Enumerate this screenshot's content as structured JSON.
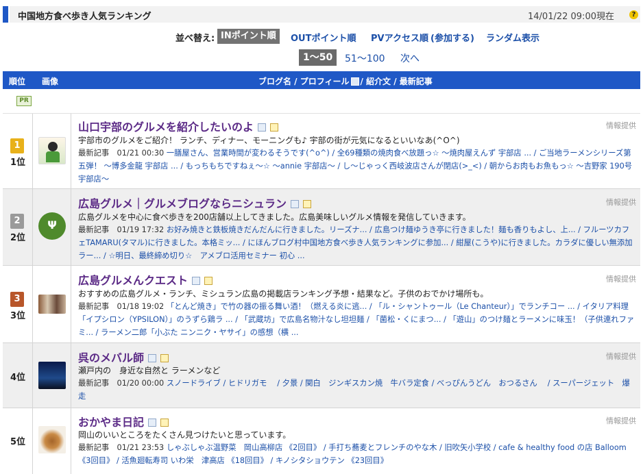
{
  "header": {
    "title": "中国地方食べ歩き人気ランキング",
    "datetime": "14/01/22 09:00現在",
    "help_icon": "question-circle-icon",
    "accent_color": "#1f58c6"
  },
  "sort": {
    "label": "並べ替え:",
    "active": "INポイント順",
    "options": [
      "OUTポイント順",
      "PVアクセス順",
      "(参加する)",
      "ランダム表示"
    ]
  },
  "pager": {
    "current": "1〜50",
    "next_range": "51〜100",
    "next": "次へ"
  },
  "table": {
    "headers": {
      "rank": "順位",
      "image": "画像",
      "main_pre": "ブログ名 / プロフィール",
      "main_post": "/ 紹介文 / 最新記事"
    },
    "pr_badge": "PR",
    "latest_label": "最新記事",
    "info_label": "情報提供"
  },
  "rows": [
    {
      "rank_num": "1",
      "rank": "1位",
      "title": "山口宇部のグルメを紹介したいのよ",
      "desc": "宇部市のグルメをご紹介！ ランチ、ディナー、モーニングも♪ 宇部の街が元気になるといいなあ(^O^)",
      "date": "01/21 00:30",
      "articles": "一膳屋さん、営業時間が変わるそうです(^o^) / 全69種類の焼肉食べ放題っ☆ 〜焼肉屋えんず 宇部店 ... / ご当地ラーメンシリーズ第五弾！ 〜博多金龍 宇部店 ... / もっちもちですねぇ〜☆ 〜annie 宇部店〜 / し〜じゃっく西岐波店さんが閉店(>_<) / 朝からお肉もお魚もっ☆ 〜吉野家 190号宇部店〜"
    },
    {
      "rank_num": "2",
      "rank": "2位",
      "title": "広島グルメ｜グルメブログならニシュラン",
      "desc": "広島グルメを中心に食べ歩きを200店舗以上してきました。広島美味しいグルメ情報を発信していきます。",
      "date": "01/19 17:32",
      "articles": "お好み焼きと鉄板焼きだんだんに行きました。リーズナ... / 広島つけ麺ゆうき亭に行きました！麺も香りもよし、上... / フルーツカフェTAMARU(タマル)に行きました。本格ミッ... / にほんブログ村中国地方食べ歩き人気ランキングに参加... / 紺屋(こうや)に行きました。カラダに優しい無添加ラー... / ☆明日、最終締め切り☆　アメブロ活用セミナー 初心 ..."
    },
    {
      "rank_num": "3",
      "rank": "3位",
      "title": "広島グルメんクエスト",
      "desc": "おすすめの広島グルメ・ランチ、ミシュラン広島の掲載店ランキング予想・結果など。子供のおでかけ場所も。",
      "date": "01/18 19:02",
      "articles": "「とんど焼き」で竹の器の振る舞い酒！（燃える炎に逃... / 「ル・シャントゥール（Le Chanteur）」でランチコー ... / イタリア料理「イプシロン（YPSILON）」のうずら鶏ラ ... / 「武蔵坊」で広島名物汁なし坦坦麺 / 「菌松・くにまつ... / 「遊山」のつけ麺とラーメンに味玉！（子供連れファミ... / ラーメン二郎「小ぶた ニンニク・ヤサイ」の感想（横 ..."
    },
    {
      "rank_num": "",
      "rank": "4位",
      "title": "呉のメバル師",
      "desc": "瀬戸内の　身近な自然と ラーメンなど",
      "date": "01/20 00:00",
      "articles": "スノードライブ / ヒドリガモ　 / 夕景 / 関白　ジンギスカン焼　牛バラ定食 / べっぴんうどん　おつるさん　 / スーパージェット　爆走"
    },
    {
      "rank_num": "",
      "rank": "5位",
      "title": "おかやま日記",
      "desc": "岡山のいいところをたくさん見つけたいと思っています。",
      "date": "01/21 23:53",
      "articles": "しゃぶしゃぶ温野菜　岡山高柳店 《2回目》 / 手打ち蕎麦とフレンチのやな木 / 旧吹矢小学校 / cafe & healthy food の店 Balloom 《3回目》 / 活魚廻転寿司 いわ栄　津高店 《18回目》 / キノシタショウテン 《23回目》"
    }
  ]
}
